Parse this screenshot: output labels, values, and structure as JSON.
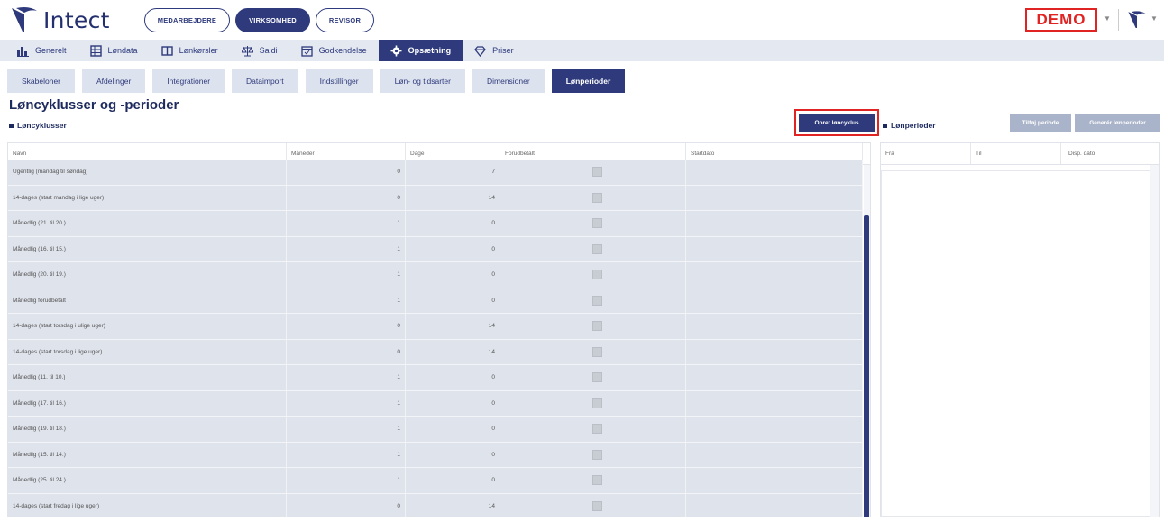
{
  "app": {
    "name": "Intect",
    "roles": [
      "MEDARBEJDERE",
      "VIRKSOMHED",
      "REVISOR"
    ],
    "active_role": "VIRKSOMHED",
    "demo_label": "DEMO"
  },
  "main_nav": [
    {
      "label": "Generelt",
      "icon": "chart-icon"
    },
    {
      "label": "Løndata",
      "icon": "table-icon"
    },
    {
      "label": "Lønkørsler",
      "icon": "columns-icon"
    },
    {
      "label": "Saldi",
      "icon": "scale-icon"
    },
    {
      "label": "Godkendelse",
      "icon": "calendar-check-icon"
    },
    {
      "label": "Opsætning",
      "icon": "gear-icon",
      "active": true
    },
    {
      "label": "Priser",
      "icon": "diamond-icon"
    }
  ],
  "sub_tabs": [
    "Skabeloner",
    "Afdelinger",
    "Integrationer",
    "Dataimport",
    "Indstillinger",
    "Løn- og tidsarter",
    "Dimensioner",
    "Lønperioder"
  ],
  "active_sub_tab": "Lønperioder",
  "page": {
    "title": "Løncyklusser og -perioder",
    "left_section": "Løncyklusser",
    "right_section": "Lønperioder",
    "create_button": "Opret løncyklus",
    "add_period_button": "Tilføj periode",
    "generate_button": "Generér lønperioder"
  },
  "cycles_table": {
    "columns": [
      "Navn",
      "Måneder",
      "Dage",
      "Forudbetalt",
      "Startdato"
    ],
    "rows": [
      {
        "name": "Ugentlig (mandag til søndag)",
        "months": "0",
        "days": "7"
      },
      {
        "name": "14-dages (start mandag i lige uger)",
        "months": "0",
        "days": "14"
      },
      {
        "name": "Månedlig (21. til 20.)",
        "months": "1",
        "days": "0"
      },
      {
        "name": "Månedlig (16. til 15.)",
        "months": "1",
        "days": "0"
      },
      {
        "name": "Månedlig (20. til 19.)",
        "months": "1",
        "days": "0"
      },
      {
        "name": "Månedlig forudbetalt",
        "months": "1",
        "days": "0"
      },
      {
        "name": "14-dages (start torsdag i ulige uger)",
        "months": "0",
        "days": "14"
      },
      {
        "name": "14-dages (start torsdag i lige uger)",
        "months": "0",
        "days": "14"
      },
      {
        "name": "Månedlig (11. til 10.)",
        "months": "1",
        "days": "0"
      },
      {
        "name": "Månedlig (17. til 16.)",
        "months": "1",
        "days": "0"
      },
      {
        "name": "Månedlig (19. til 18.)",
        "months": "1",
        "days": "0"
      },
      {
        "name": "Månedlig (15. til 14.)",
        "months": "1",
        "days": "0"
      },
      {
        "name": "Månedlig (25. til 24.)",
        "months": "1",
        "days": "0"
      },
      {
        "name": "14-dages (start fredag i lige uger)",
        "months": "0",
        "days": "14"
      }
    ]
  },
  "periods_table": {
    "columns": [
      "Fra",
      "Til",
      "Disp. dato"
    ]
  },
  "colors": {
    "primary": "#2e3a7c",
    "demo": "#e02424",
    "row_bg": "#dfe3ec"
  }
}
